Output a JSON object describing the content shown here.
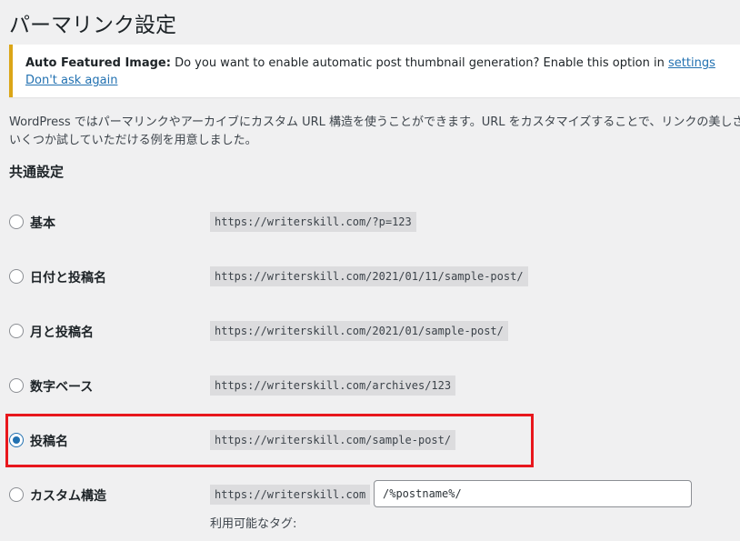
{
  "page": {
    "title": "パーマリンク設定"
  },
  "notice": {
    "strong": "Auto Featured Image:",
    "message": " Do you want to enable automatic post thumbnail generation? Enable this option in ",
    "settings_link": "settings",
    "dismiss_link": "Don't ask again",
    "border_color": "#dba617"
  },
  "intro": {
    "line1": "WordPress ではパーマリンクやアーカイブにカスタム URL 構造を使うことができます。URL をカスタマイズすることで、リンクの美しさや",
    "line2": "いくつか試していただける例を用意しました。"
  },
  "common": {
    "title": "共通設定",
    "options": [
      {
        "label": "基本",
        "example": "https://writerskill.com/?p=123",
        "checked": false
      },
      {
        "label": "日付と投稿名",
        "example": "https://writerskill.com/2021/01/11/sample-post/",
        "checked": false
      },
      {
        "label": "月と投稿名",
        "example": "https://writerskill.com/2021/01/sample-post/",
        "checked": false
      },
      {
        "label": "数字ベース",
        "example": "https://writerskill.com/archives/123",
        "checked": false
      },
      {
        "label": "投稿名",
        "example": "https://writerskill.com/sample-post/",
        "checked": true
      },
      {
        "label": "カスタム構造",
        "example": "https://writerskill.com",
        "checked": false
      }
    ],
    "custom_value": "/%postname%/",
    "available_tags": "利用可能なタグ:"
  },
  "colors": {
    "accent": "#2271b1",
    "highlight": "#e8171d",
    "background": "#f0f0f1"
  }
}
